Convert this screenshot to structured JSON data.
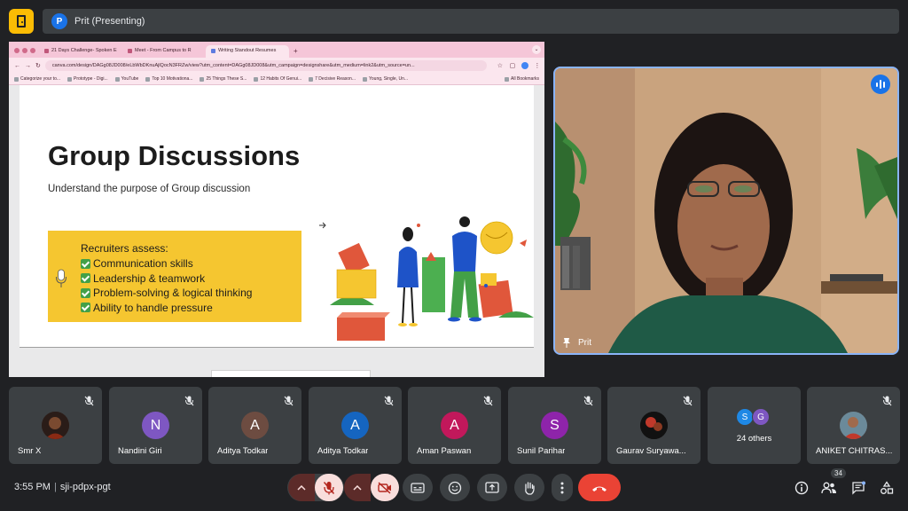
{
  "topbar": {
    "presenter_initial": "P",
    "presenter_text": "Prit (Presenting)"
  },
  "browser": {
    "tabs": [
      "21 Days Challenge- Spoken E",
      "Meet - From Campus to R",
      "Writing Standout Resumes"
    ],
    "url": "canva.com/design/DAGg08JD008/eLbWbDKnuAjlQocN3FRZw/view?utm_content=DAGg08JD008&utm_campaign=designshare&utm_medium=link2&utm_source=un...",
    "bookmarks": [
      "Categorize your to...",
      "Prototype - Digi...",
      "YouTube",
      "Top 10 Motivationa...",
      "25 Things These S...",
      "12 Habits Of Genui...",
      "7 Decisive Reason...",
      "Young, Single, Un..."
    ],
    "all_bookmarks": "All Bookmarks"
  },
  "slide": {
    "title": "Group Discussions",
    "subtitle": "Understand the purpose of Group discussion",
    "box_heading": "Recruiters assess:",
    "box_items": [
      "Communication skills",
      "Leadership & teamwork",
      "Problem-solving & logical thinking",
      "Ability to handle pressure"
    ]
  },
  "video": {
    "name": "Prit"
  },
  "participants": [
    {
      "name": "Smr X",
      "initial": "",
      "color": "#6b3a2a",
      "type": "photo"
    },
    {
      "name": "Nandini Giri",
      "initial": "N",
      "color": "#7e57c2",
      "type": "letter"
    },
    {
      "name": "Aditya Todkar",
      "initial": "A",
      "color": "#6d4c41",
      "type": "letter"
    },
    {
      "name": "Aditya Todkar",
      "initial": "A",
      "color": "#1565c0",
      "type": "letter"
    },
    {
      "name": "Aman Paswan",
      "initial": "A",
      "color": "#c2185b",
      "type": "letter"
    },
    {
      "name": "Sunil Parihar",
      "initial": "S",
      "color": "#8e24aa",
      "type": "letter"
    },
    {
      "name": "Gaurav Suryawa...",
      "initial": "",
      "color": "#3e2723",
      "type": "photo"
    },
    {
      "name": "ANIKET CHITRAS...",
      "initial": "",
      "color": "#5d4037",
      "type": "photo"
    }
  ],
  "others": {
    "label": "24 others",
    "initials": [
      "S",
      "G"
    ],
    "colors": [
      "#1e88e5",
      "#7e57c2"
    ]
  },
  "bottom": {
    "time": "3:55 PM",
    "meeting_code": "sji-pdpx-pgt",
    "people_count": "34"
  },
  "colors": {
    "end_call": "#ea4335",
    "muted_bg": "#f9dedc",
    "muted_icon": "#b3261e",
    "active_speaker_border": "#8ab4f8"
  }
}
